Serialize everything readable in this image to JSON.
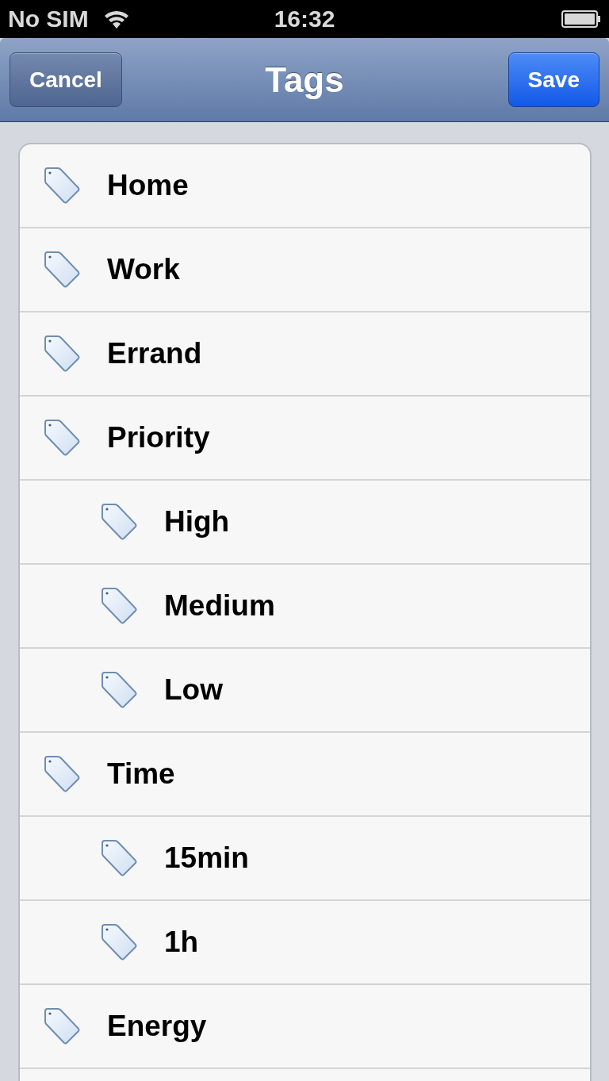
{
  "status_bar": {
    "carrier": "No SIM",
    "time": "16:32"
  },
  "nav_bar": {
    "title": "Tags",
    "left_button": "Cancel",
    "right_button": "Save"
  },
  "tags": [
    {
      "label": "Home"
    },
    {
      "label": "Work"
    },
    {
      "label": "Errand"
    },
    {
      "label": "Priority",
      "children": [
        {
          "label": "High"
        },
        {
          "label": "Medium"
        },
        {
          "label": "Low"
        }
      ]
    },
    {
      "label": "Time",
      "children": [
        {
          "label": "15min"
        },
        {
          "label": "1h"
        }
      ]
    },
    {
      "label": "Energy"
    }
  ]
}
